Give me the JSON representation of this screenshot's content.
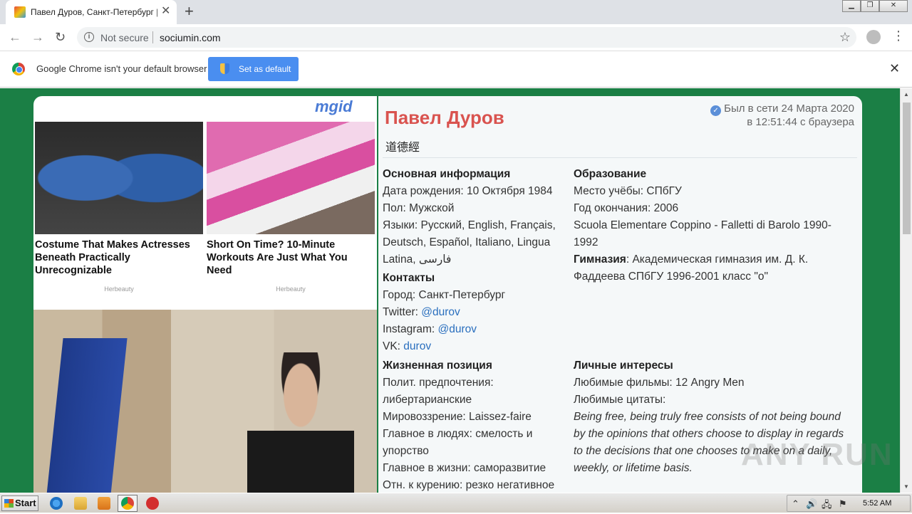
{
  "browser": {
    "tab_title": "Павел Дуров, Санкт-Петербург | С",
    "tab_close": "✕",
    "new_tab": "+",
    "window_controls": [
      "▁",
      "❐",
      "✕"
    ],
    "nav": {
      "back": "←",
      "forward": "→",
      "reload": "↻"
    },
    "not_secure": "Not secure",
    "url": "sociumin.com",
    "info_icon": "i",
    "star": "☆",
    "menu": "⋮"
  },
  "infobar": {
    "message": "Google Chrome isn't your default browser",
    "button": "Set as default",
    "close": "✕"
  },
  "ads": {
    "brand": "mgid",
    "items": [
      {
        "caption": "Costume That Makes Actresses Beneath Practically Unrecognizable",
        "source": "Herbeauty"
      },
      {
        "caption": "Short On Time? 10-Minute Workouts Are Just What You Need",
        "source": "Herbeauty"
      }
    ]
  },
  "profile": {
    "name": "Павел Дуров",
    "online_line1": "Был в сети 24 Марта 2020",
    "online_line2": "в 12:51:44 с браузера",
    "verified": "✓",
    "status": "道德經",
    "basic": {
      "title": "Основная информация",
      "birth": "Дата рождения: 10 Октября 1984",
      "gender": "Пол: Мужской",
      "languages": "Языки: Русский, English, Français, Deutsch, Español, Italiano, Lingua Latina, فارسی"
    },
    "contacts": {
      "title": "Контакты",
      "city": "Город: Санкт-Петербург",
      "twitter_label": "Twitter: ",
      "twitter": "@durov",
      "instagram_label": "Instagram: ",
      "instagram": "@durov",
      "vk_label": "VK: ",
      "vk": "durov"
    },
    "education": {
      "title": "Образование",
      "place": "Место учёбы: СПбГУ",
      "year": "Год окончания: 2006",
      "school": "Scuola Elementare Coppino - Falletti di Barolo 1990-1992",
      "gym_label": "Гимназия",
      "gym": ": Академическая гимназия им. Д. К. Фаддеева СПбГУ 1996-2001 класс \"о\""
    },
    "position": {
      "title": "Жизненная позиция",
      "politics": "Полит. предпочтения: либертарианские",
      "worldview": "Мировоззрение: Laissez-faire",
      "people": "Главное в людях: смелость и упорство",
      "life": "Главное в жизни: саморазвитие",
      "smoking": "Отн. к курению: резко негативное"
    },
    "interests": {
      "title": "Личные интересы",
      "movies": "Любимые фильмы: 12 Angry Men",
      "quotes_label": "Любимые цитаты:",
      "quote": "Being free, being truly free consists of not being bound by the opinions that others choose to display in regards to the decisions that one chooses to make on a daily, weekly, or lifetime basis."
    }
  },
  "watermark": "ANY RUN",
  "taskbar": {
    "start": "Start",
    "time": "5:52 AM"
  }
}
